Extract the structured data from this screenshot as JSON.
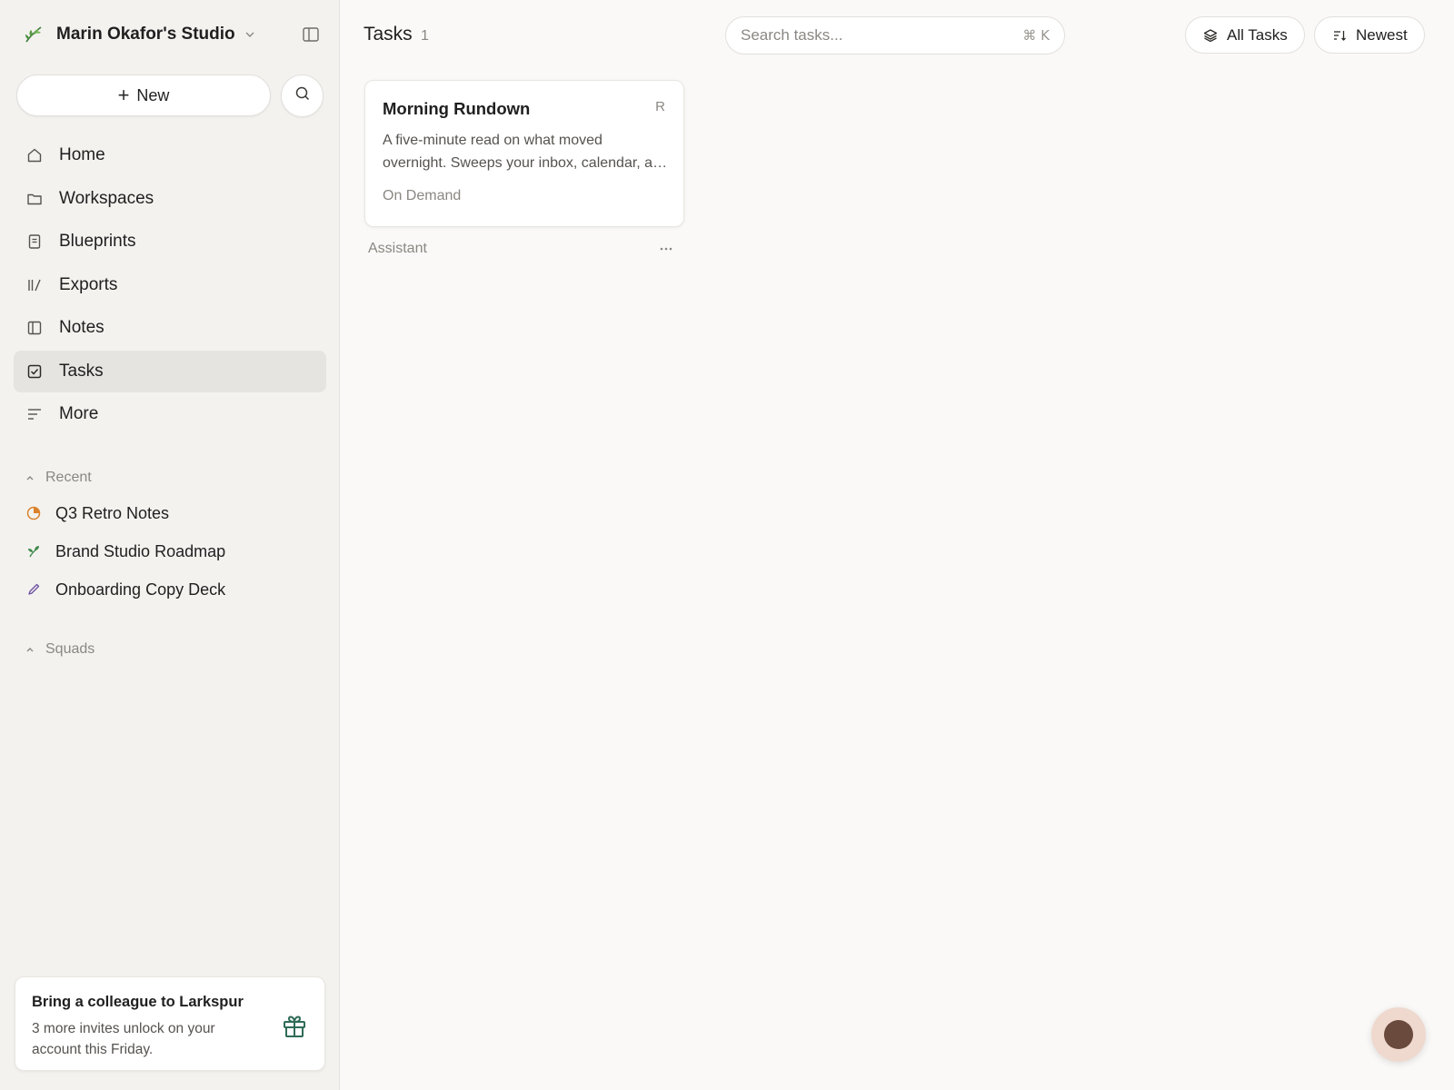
{
  "workspace": {
    "name": "Marin Okafor's Studio"
  },
  "sidebar": {
    "new_label": "New",
    "nav": [
      {
        "label": "Home",
        "icon": "home-icon"
      },
      {
        "label": "Workspaces",
        "icon": "folder-icon"
      },
      {
        "label": "Blueprints",
        "icon": "document-icon"
      },
      {
        "label": "Exports",
        "icon": "library-icon"
      },
      {
        "label": "Notes",
        "icon": "notebook-icon"
      },
      {
        "label": "Tasks",
        "icon": "checkbox-icon",
        "active": true
      },
      {
        "label": "More",
        "icon": "lines-icon"
      }
    ],
    "recent_heading": "Recent",
    "recent": [
      {
        "label": "Q3 Retro Notes",
        "icon": "pie-icon"
      },
      {
        "label": "Brand Studio Roadmap",
        "icon": "sprout-icon"
      },
      {
        "label": "Onboarding Copy Deck",
        "icon": "pen-icon"
      }
    ],
    "squads_heading": "Squads",
    "invite": {
      "title": "Bring a colleague to Larkspur",
      "body": "3 more invites unlock on your account this Friday."
    }
  },
  "main": {
    "title": "Tasks",
    "count": "1",
    "search": {
      "placeholder": "Search tasks...",
      "shortcut": "⌘ K"
    },
    "filter_label": "All Tasks",
    "sort_label": "Newest",
    "task": {
      "title": "Morning Rundown",
      "badge": "R",
      "desc_line1": "A five-minute read on what moved",
      "desc_line2": "overnight. Sweeps your inbox, calendar, and docs",
      "trigger": "On Demand",
      "owner": "Assistant"
    }
  },
  "colors": {
    "sidebar_bg": "#f3f2ef",
    "main_bg": "#faf9f7",
    "active_item": "#e6e4e0",
    "gift_green": "#2f6b57",
    "pie_orange": "#d9822b",
    "sprout_green": "#3f8a4a",
    "pen_purple": "#6b4fa0"
  }
}
